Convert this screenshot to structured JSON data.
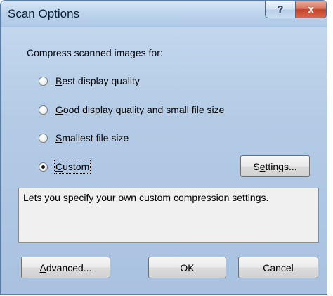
{
  "window": {
    "title": "Scan Options",
    "help_glyph": "?",
    "close_glyph": "x"
  },
  "compress_label": "Compress scanned images for:",
  "options": [
    {
      "pre": "",
      "mnemonic": "B",
      "rest": "est display quality",
      "checked": false
    },
    {
      "pre": "",
      "mnemonic": "G",
      "rest": "ood display quality and small file size",
      "checked": false
    },
    {
      "pre": "",
      "mnemonic": "S",
      "rest": "mallest file size",
      "checked": false
    },
    {
      "pre": "",
      "mnemonic": "C",
      "rest": "ustom",
      "checked": true
    }
  ],
  "settings_button": {
    "pre": "S",
    "mnemonic": "e",
    "rest": "ttings..."
  },
  "description": "Lets you specify your own custom compression settings.",
  "advanced_button": {
    "pre": "",
    "mnemonic": "A",
    "rest": "dvanced..."
  },
  "ok_label": "OK",
  "cancel_label": "Cancel"
}
